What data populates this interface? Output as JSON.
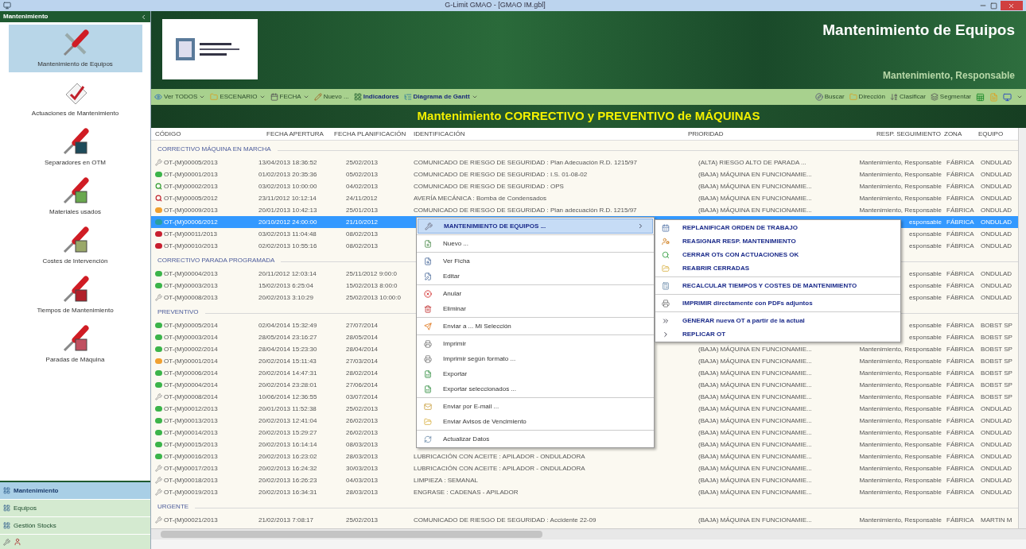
{
  "window": {
    "title": "G-Limit GMAO - [GMAO IM.gbl]"
  },
  "sidebar": {
    "title": "Mantenimiento",
    "items": [
      {
        "label": "Mantenimiento de Equipos",
        "kind": "tools",
        "selected": true
      },
      {
        "label": "Actuaciones de Mantenimiento",
        "kind": "checklist",
        "selected": false
      },
      {
        "label": "Separadores en OTM",
        "kind": "screen",
        "selected": false
      },
      {
        "label": "Materiales usados",
        "kind": "material",
        "selected": false
      },
      {
        "label": "Costes de Intervención",
        "kind": "cost",
        "selected": false
      },
      {
        "label": "Tiempos de Mantenimiento",
        "kind": "time",
        "selected": false
      },
      {
        "label": "Paradas de Máquina",
        "kind": "stop",
        "selected": false
      }
    ],
    "nav": [
      {
        "label": "Mantenimiento",
        "selected": true
      },
      {
        "label": "Equipos",
        "selected": false
      },
      {
        "label": "Gestión Stocks",
        "selected": false
      }
    ]
  },
  "header": {
    "title": "Mantenimiento de Equipos",
    "subtitle": "Mantenimiento, Responsable"
  },
  "toolbar": {
    "left": [
      {
        "label": "Ver TODOS",
        "dropdown": true,
        "emphasis": false
      },
      {
        "label": "ESCENARIO",
        "dropdown": true,
        "emphasis": false
      },
      {
        "label": "FECHA",
        "dropdown": true,
        "emphasis": false
      },
      {
        "label": "Nuevo ...",
        "dropdown": false,
        "emphasis": false
      },
      {
        "label": "Indicadores",
        "dropdown": false,
        "emphasis": true
      },
      {
        "label": "Diagrama de Gantt",
        "dropdown": true,
        "emphasis": true
      }
    ],
    "right": [
      {
        "label": "Buscar"
      },
      {
        "label": "Dirección"
      },
      {
        "label": "Clasificar"
      },
      {
        "label": "Segmentar"
      }
    ]
  },
  "banner": "Mantenimiento CORRECTIVO y PREVENTIVO de MÁQUINAS",
  "table": {
    "columns": [
      "CÓDIGO",
      "FECHA APERTURA",
      "FECHA PLANIFICACIÓN",
      "IDENTIFICACIÓN",
      "PRIORIDAD",
      "RESP. SEGUIMIENTO",
      "ZONA",
      "EQUIPO"
    ],
    "groups": [
      {
        "title": "CORRECTIVO MÁQUINA EN MARCHA",
        "rows": [
          {
            "kind": "wrench",
            "selected": false,
            "code": "OT-(M)00005/2013",
            "opened": "13/04/2013 18:36:52",
            "planned": "25/02/2013",
            "identification": "COMUNICADO DE RIESGO DE SEGURIDAD : Plan Adecuación R.D. 1215/97",
            "priority": "(ALTA) RIESGO ALTO DE PARADA ...",
            "responsible": "Mantenimiento, Responsable",
            "zone": "FÁBRICA",
            "equipment": "ONDULAD"
          },
          {
            "kind": "green",
            "selected": false,
            "code": "OT-(M)00001/2013",
            "opened": "01/02/2013 20:35:36",
            "planned": "05/02/2013",
            "identification": "COMUNICADO DE RIESGO DE SEGURIDAD : I.S. 01-08-02",
            "priority": "(BAJA) MÁQUINA EN FUNCIONAMIE...",
            "responsible": "Mantenimiento, Responsable",
            "zone": "FÁBRICA",
            "equipment": "ONDULAD"
          },
          {
            "kind": "search_green",
            "selected": false,
            "code": "OT-(M)00002/2013",
            "opened": "03/02/2013 10:00:00",
            "planned": "04/02/2013",
            "identification": "COMUNICADO DE RIESGO DE SEGURIDAD : OPS",
            "priority": "(BAJA) MÁQUINA EN FUNCIONAMIE...",
            "responsible": "Mantenimiento, Responsable",
            "zone": "FÁBRICA",
            "equipment": "ONDULAD"
          },
          {
            "kind": "search_red",
            "selected": false,
            "code": "OT-(M)00005/2012",
            "opened": "23/11/2012 10:12:14",
            "planned": "24/11/2012",
            "identification": "AVERÍA MECÁNICA : Bomba de Condensados",
            "priority": "(BAJA) MÁQUINA EN FUNCIONAMIE...",
            "responsible": "Mantenimiento, Responsable",
            "zone": "FÁBRICA",
            "equipment": "ONDULAD"
          },
          {
            "kind": "orange",
            "selected": false,
            "code": "OT-(M)00009/2013",
            "opened": "20/01/2013 10:42:13",
            "planned": "25/01/2013",
            "identification": "COMUNICADO DE RIESGO DE SEGURIDAD : Plan adecuación R.D. 1215/97",
            "priority": "(BAJA) MÁQUINA EN FUNCIONAMIE...",
            "responsible": "Mantenimiento, Responsable",
            "zone": "FÁBRICA",
            "equipment": "ONDULAD"
          },
          {
            "kind": "teal",
            "selected": true,
            "code": "OT-(M)00006/2012",
            "opened": "20/10/2012 24:00:00",
            "planned": "21/10/2012",
            "responsible": "esponsable",
            "zone": "FÁBRICA",
            "equipment": "ONDULAD"
          },
          {
            "kind": "red",
            "selected": false,
            "code": "OT-(M)00011/2013",
            "opened": "03/02/2013 11:04:48",
            "planned": "08/02/2013",
            "responsible": "esponsable",
            "zone": "FÁBRICA",
            "equipment": "ONDULAD"
          },
          {
            "kind": "red",
            "selected": false,
            "code": "OT-(M)00010/2013",
            "opened": "02/02/2013 10:55:16",
            "planned": "08/02/2013",
            "responsible": "esponsable",
            "zone": "FÁBRICA",
            "equipment": "ONDULAD"
          }
        ]
      },
      {
        "title": "CORRECTIVO PARADA PROGRAMADA",
        "rows": [
          {
            "kind": "green",
            "selected": false,
            "code": "OT-(M)00004/2013",
            "opened": "20/11/2012 12:03:14",
            "planned": "25/11/2012 9:00:0",
            "responsible": "esponsable",
            "zone": "FÁBRICA",
            "equipment": "ONDULAD"
          },
          {
            "kind": "green",
            "selected": false,
            "code": "OT-(M)00003/2013",
            "opened": "15/02/2013 6:25:04",
            "planned": "15/02/2013 8:00:0",
            "responsible": "esponsable",
            "zone": "FÁBRICA",
            "equipment": "ONDULAD"
          },
          {
            "kind": "wrench",
            "selected": false,
            "code": "OT-(M)00008/2013",
            "opened": "20/02/2013 3:10:29",
            "planned": "25/02/2013 10:00:0",
            "responsible": "esponsable",
            "zone": "FÁBRICA",
            "equipment": "ONDULAD"
          }
        ]
      },
      {
        "title": "PREVENTIVO",
        "rows": [
          {
            "kind": "green",
            "selected": false,
            "code": "OT-(M)00005/2014",
            "opened": "02/04/2014 15:32:49",
            "planned": "27/07/2014",
            "responsible": "esponsable",
            "zone": "FÁBRICA",
            "equipment": "BOBST SP"
          },
          {
            "kind": "green",
            "selected": false,
            "code": "OT-(M)00003/2014",
            "opened": "28/05/2014 23:16:27",
            "planned": "28/05/2014",
            "responsible": "esponsable",
            "zone": "FÁBRICA",
            "equipment": "BOBST SP"
          },
          {
            "kind": "green",
            "selected": false,
            "code": "OT-(M)00002/2014",
            "opened": "28/04/2014 15:23:30",
            "planned": "28/04/2014",
            "priority": "(BAJA) MÁQUINA EN FUNCIONAMIE...",
            "responsible": "Mantenimiento, Responsable",
            "zone": "FÁBRICA",
            "equipment": "BOBST SP"
          },
          {
            "kind": "orange",
            "selected": false,
            "code": "OT-(M)00001/2014",
            "opened": "20/02/2014 15:11:43",
            "planned": "27/03/2014",
            "priority": "(BAJA) MÁQUINA EN FUNCIONAMIE...",
            "responsible": "Mantenimiento, Responsable",
            "zone": "FÁBRICA",
            "equipment": "BOBST SP"
          },
          {
            "kind": "green",
            "selected": false,
            "code": "OT-(M)00006/2014",
            "opened": "20/02/2014 14:47:31",
            "planned": "28/02/2014",
            "priority": "(BAJA) MÁQUINA EN FUNCIONAMIE...",
            "responsible": "Mantenimiento, Responsable",
            "zone": "FÁBRICA",
            "equipment": "BOBST SP"
          },
          {
            "kind": "green",
            "selected": false,
            "code": "OT-(M)00004/2014",
            "opened": "20/02/2014 23:28:01",
            "planned": "27/06/2014",
            "priority": "(BAJA) MÁQUINA EN FUNCIONAMIE...",
            "responsible": "Mantenimiento, Responsable",
            "zone": "FÁBRICA",
            "equipment": "BOBST SP"
          },
          {
            "kind": "wrench",
            "selected": false,
            "code": "OT-(M)00008/2014",
            "opened": "10/06/2014 12:36:55",
            "planned": "03/07/2014",
            "priority": "(BAJA) MÁQUINA EN FUNCIONAMIE...",
            "responsible": "Mantenimiento, Responsable",
            "zone": "FÁBRICA",
            "equipment": "BOBST SP"
          },
          {
            "kind": "green",
            "selected": false,
            "code": "OT-(M)00012/2013",
            "opened": "20/01/2013 11:52:38",
            "planned": "25/02/2013",
            "priority": "(BAJA) MÁQUINA EN FUNCIONAMIE...",
            "responsible": "Mantenimiento, Responsable",
            "zone": "FÁBRICA",
            "equipment": "ONDULAD"
          },
          {
            "kind": "green",
            "selected": false,
            "code": "OT-(M)00013/2013",
            "opened": "20/02/2013 12:41:04",
            "planned": "26/02/2013",
            "priority": "(BAJA) MÁQUINA EN FUNCIONAMIE...",
            "responsible": "Mantenimiento, Responsable",
            "zone": "FÁBRICA",
            "equipment": "ONDULAD"
          },
          {
            "kind": "green",
            "selected": false,
            "code": "OT-(M)00014/2013",
            "opened": "20/02/2013 15:29:27",
            "planned": "26/02/2013",
            "priority": "(BAJA) MÁQUINA EN FUNCIONAMIE...",
            "responsible": "Mantenimiento, Responsable",
            "zone": "FÁBRICA",
            "equipment": "ONDULAD"
          },
          {
            "kind": "green",
            "selected": false,
            "code": "OT-(M)00015/2013",
            "opened": "20/02/2013 16:14:14",
            "planned": "08/03/2013",
            "priority": "(BAJA) MÁQUINA EN FUNCIONAMIE...",
            "responsible": "Mantenimiento, Responsable",
            "zone": "FÁBRICA",
            "equipment": "ONDULAD"
          },
          {
            "kind": "green",
            "selected": false,
            "code": "OT-(M)00016/2013",
            "opened": "20/02/2013 16:23:02",
            "planned": "28/03/2013",
            "identification": "LUBRICACIÓN CON ACEITE : APILADOR - ONDULADORA",
            "priority": "(BAJA) MÁQUINA EN FUNCIONAMIE...",
            "responsible": "Mantenimiento, Responsable",
            "zone": "FÁBRICA",
            "equipment": "ONDULAD"
          },
          {
            "kind": "wrench",
            "selected": false,
            "code": "OT-(M)00017/2013",
            "opened": "20/02/2013 16:24:32",
            "planned": "30/03/2013",
            "identification": "LUBRICACIÓN CON ACEITE : APILADOR - ONDULADORA",
            "priority": "(BAJA) MÁQUINA EN FUNCIONAMIE...",
            "responsible": "Mantenimiento, Responsable",
            "zone": "FÁBRICA",
            "equipment": "ONDULAD"
          },
          {
            "kind": "wrench",
            "selected": false,
            "code": "OT-(M)00018/2013",
            "opened": "20/02/2013 16:26:23",
            "planned": "04/03/2013",
            "identification": "LIMPIEZA : SEMANAL",
            "priority": "(BAJA) MÁQUINA EN FUNCIONAMIE...",
            "responsible": "Mantenimiento, Responsable",
            "zone": "FÁBRICA",
            "equipment": "ONDULAD"
          },
          {
            "kind": "wrench",
            "selected": false,
            "code": "OT-(M)00019/2013",
            "opened": "20/02/2013 16:34:31",
            "planned": "28/03/2013",
            "identification": "ENGRASE : CADENAS - APILADOR",
            "priority": "(BAJA) MÁQUINA EN FUNCIONAMIE...",
            "responsible": "Mantenimiento, Responsable",
            "zone": "FÁBRICA",
            "equipment": "ONDULAD"
          }
        ]
      },
      {
        "title": "URGENTE",
        "rows": [
          {
            "kind": "wrench",
            "selected": false,
            "code": "OT-(M)00021/2013",
            "opened": "21/02/2013 7:08:17",
            "planned": "25/02/2013",
            "identification": "COMUNICADO DE RIESGO DE SEGURIDAD : Accidente 22-09",
            "priority": "(BAJA) MÁQUINA EN FUNCIONAMIE...",
            "responsible": "Mantenimiento, Responsable",
            "zone": "FÁBRICA",
            "equipment": "MARTIN M"
          }
        ]
      }
    ]
  },
  "context_menu": {
    "groups": [
      [
        {
          "label": "MANTENIMIENTO DE EQUIPOS ...",
          "highlighted": true,
          "submenu": true
        }
      ],
      [
        {
          "label": "Nuevo ...",
          "highlighted": false
        }
      ],
      [
        {
          "label": "Ver Ficha",
          "highlighted": false
        },
        {
          "label": "Editar",
          "highlighted": false
        }
      ],
      [
        {
          "label": "Anular",
          "highlighted": false
        },
        {
          "label": "Eliminar",
          "highlighted": false
        }
      ],
      [
        {
          "label": "Enviar a ... Mi Selección",
          "highlighted": false
        }
      ],
      [
        {
          "label": "Imprimir",
          "highlighted": false
        },
        {
          "label": "Imprimir según formato ...",
          "highlighted": false
        },
        {
          "label": "Exportar",
          "highlighted": false
        },
        {
          "label": "Exportar seleccionados ...",
          "highlighted": false
        }
      ],
      [
        {
          "label": "Enviar por E-mail ...",
          "highlighted": false
        },
        {
          "label": "Enviar Avisos de Vencimiento",
          "highlighted": false
        }
      ],
      [
        {
          "label": "Actualizar Datos",
          "highlighted": false
        }
      ]
    ]
  },
  "submenu": {
    "groups": [
      [
        "REPLANIFICAR ORDEN DE TRABAJO",
        "REASIGNAR RESP. MANTENIMIENTO",
        "CERRAR OTs CON ACTUACIONES OK",
        "REABRIR CERRADAS"
      ],
      [
        "RECALCULAR TIEMPOS Y COSTES DE MANTENIMIENTO"
      ],
      [
        "IMPRIMIR directamente con PDFs adjuntos"
      ],
      [
        "GENERAR nueva OT a partir de la actual",
        "REPLICAR OT"
      ]
    ]
  }
}
